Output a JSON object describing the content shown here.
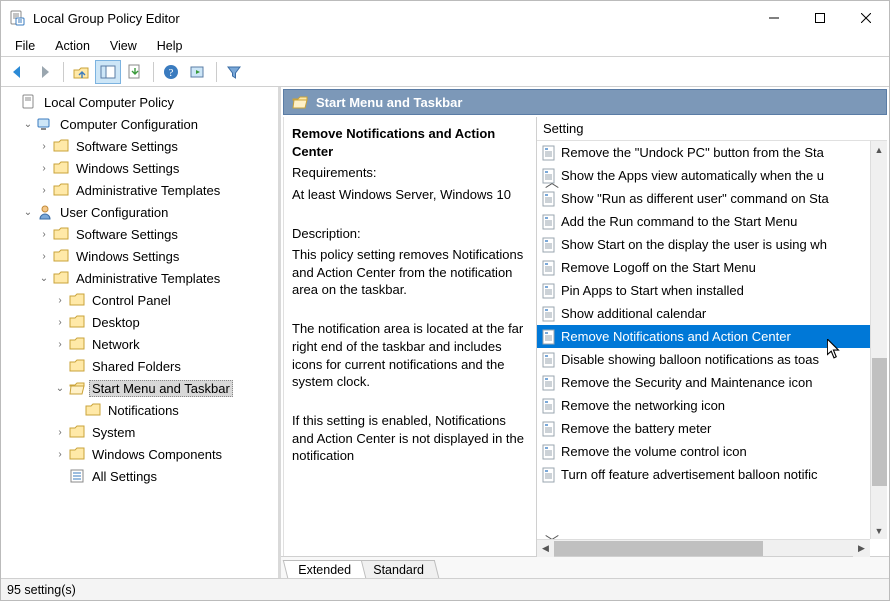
{
  "window": {
    "title": "Local Group Policy Editor"
  },
  "menu": {
    "file": "File",
    "action": "Action",
    "view": "View",
    "help": "Help"
  },
  "toolbar": {
    "back": "back-icon",
    "forward": "forward-icon",
    "up": "up-icon",
    "show_tree": "show-tree-icon",
    "export": "export-icon",
    "refresh": "refresh-icon",
    "run": "run-icon",
    "filter": "filter-icon"
  },
  "tree": {
    "root": "Local Computer Policy",
    "computer_config": "Computer Configuration",
    "cc_software": "Software Settings",
    "cc_windows": "Windows Settings",
    "cc_admin": "Administrative Templates",
    "user_config": "User Configuration",
    "uc_software": "Software Settings",
    "uc_windows": "Windows Settings",
    "uc_admin": "Administrative Templates",
    "control_panel": "Control Panel",
    "desktop": "Desktop",
    "network": "Network",
    "shared_folders": "Shared Folders",
    "start_menu": "Start Menu and Taskbar",
    "notifications": "Notifications",
    "system": "System",
    "windows_components": "Windows Components",
    "all_settings": "All Settings"
  },
  "header": {
    "title": "Start Menu and Taskbar"
  },
  "description": {
    "title": "Remove Notifications and Action Center",
    "req_label": "Requirements:",
    "req_value": "At least Windows Server, Windows 10",
    "desc_label": "Description:",
    "desc_p1": "This policy setting removes Notifications and Action Center from the notification area on the taskbar.",
    "desc_p2": "The notification area is located at the far right end of the taskbar and includes icons for current notifications and the system clock.",
    "desc_p3": "If this setting is enabled, Notifications and Action Center is not displayed in the notification"
  },
  "list": {
    "column": "Setting",
    "items": [
      "Remove the \"Undock PC\" button from the Sta",
      "Show the Apps view automatically when the u",
      "Show \"Run as different user\" command on Sta",
      "Add the Run command to the Start Menu",
      "Show Start on the display the user is using wh",
      "Remove Logoff on the Start Menu",
      "Pin Apps to Start when installed",
      "Show additional calendar",
      "Remove Notifications and Action Center",
      "Disable showing balloon notifications as toas",
      "Remove the Security and Maintenance icon",
      "Remove the networking icon",
      "Remove the battery meter",
      "Remove the volume control icon",
      "Turn off feature advertisement balloon notific"
    ],
    "selected_index": 8
  },
  "tabs": {
    "extended": "Extended",
    "standard": "Standard"
  },
  "status": {
    "text": "95 setting(s)"
  }
}
